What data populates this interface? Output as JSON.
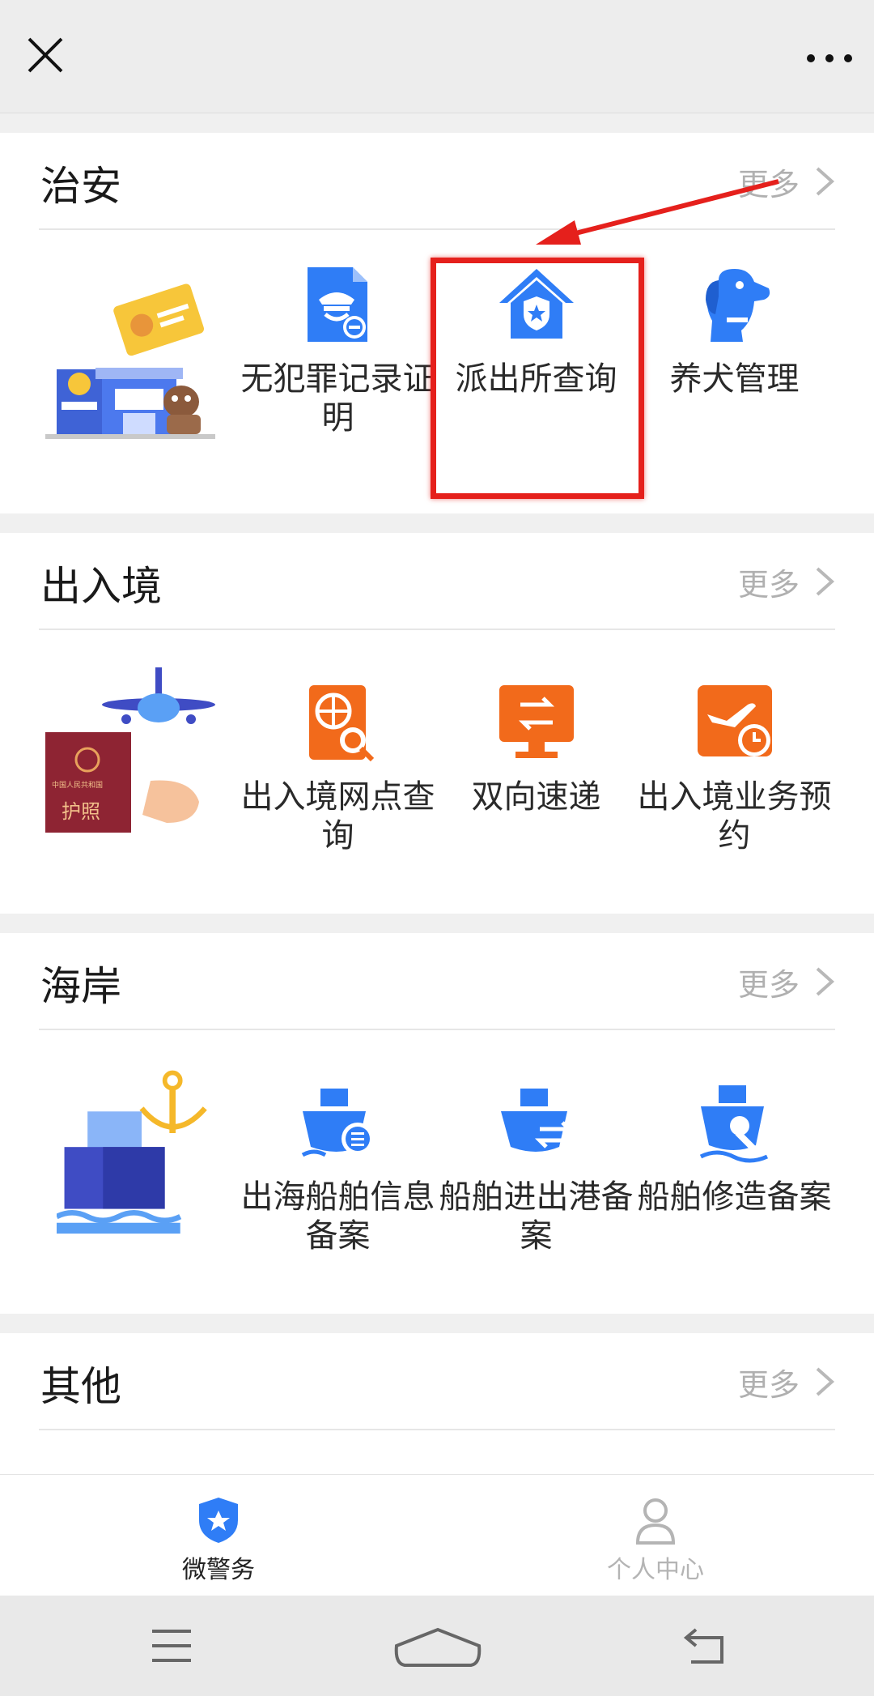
{
  "sections": [
    {
      "title": "治安",
      "more": "更多",
      "items": [
        {
          "label": "无犯罪记录证明",
          "icon": "police-certificate-icon"
        },
        {
          "label": "派出所查询",
          "icon": "police-station-icon"
        },
        {
          "label": "养犬管理",
          "icon": "dog-icon"
        }
      ]
    },
    {
      "title": "出入境",
      "more": "更多",
      "banner_text": "护照",
      "banner_small": "中国人民共和国",
      "items": [
        {
          "label": "出入境网点查询",
          "icon": "passport-search-icon"
        },
        {
          "label": "双向速递",
          "icon": "two-way-delivery-icon"
        },
        {
          "label": "出入境业务预约",
          "icon": "flight-appointment-icon"
        }
      ]
    },
    {
      "title": "海岸",
      "more": "更多",
      "items": [
        {
          "label": "出海船舶信息备案",
          "icon": "ship-info-icon"
        },
        {
          "label": "船舶进出港备案",
          "icon": "ship-port-icon"
        },
        {
          "label": "船舶修造备案",
          "icon": "ship-repair-icon"
        }
      ]
    },
    {
      "title": "其他",
      "more": "更多"
    }
  ],
  "tabs": [
    {
      "label": "微警务",
      "icon": "police-badge-icon",
      "active": true
    },
    {
      "label": "个人中心",
      "icon": "person-icon",
      "active": false
    }
  ],
  "colors": {
    "blue": "#2f7df6",
    "orange": "#f26a1b",
    "highlight": "#e5201c"
  }
}
